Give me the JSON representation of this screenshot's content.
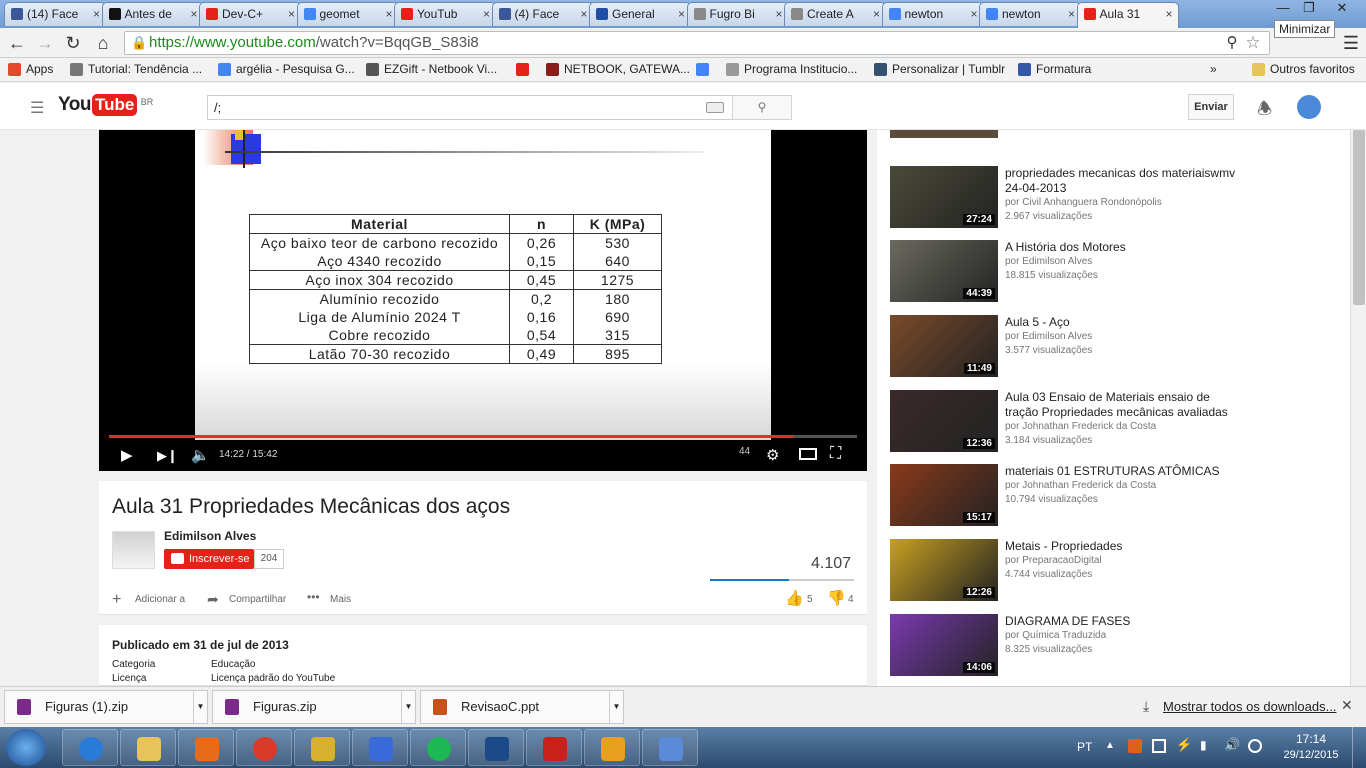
{
  "browser": {
    "tabs": [
      {
        "label": "(14) Face",
        "color": "#3b5998"
      },
      {
        "label": "Antes de",
        "color": "#111111"
      },
      {
        "label": "Dev-C+",
        "color": "#e62117"
      },
      {
        "label": "geomet",
        "color": "#4285f4"
      },
      {
        "label": "YouTub",
        "color": "#e62117"
      },
      {
        "label": "(4) Face",
        "color": "#3b5998"
      },
      {
        "label": "General",
        "color": "#1d4ea3"
      },
      {
        "label": "Fugro Bi",
        "color": "#888888"
      },
      {
        "label": "Create A",
        "color": "#888888"
      },
      {
        "label": "newton",
        "color": "#4285f4"
      },
      {
        "label": "newton",
        "color": "#4285f4"
      },
      {
        "label": "Aula 31",
        "color": "#e62117"
      }
    ],
    "tooltip": "Minimizar",
    "url_host": "https://www.youtube.com",
    "url_path": "/watch?v=BqqGB_S83i8",
    "bookmarks": [
      {
        "label": "Apps",
        "color": "#e04a2a"
      },
      {
        "label": "Tutorial: Tendência ...",
        "color": "#777777"
      },
      {
        "label": "argélia - Pesquisa G...",
        "color": "#4285f4"
      },
      {
        "label": "EZGift - Netbook Vi...",
        "color": "#555555"
      },
      {
        "label": "",
        "color": "#e62117"
      },
      {
        "label": "NETBOOK, GATEWA...",
        "color": "#8b1c1c"
      },
      {
        "label": "",
        "color": "#4285f4"
      },
      {
        "label": "Programa Institucio...",
        "color": "#999999"
      },
      {
        "label": "Personalizar | Tumblr",
        "color": "#34526f"
      },
      {
        "label": "Formatura",
        "color": "#3355aa"
      }
    ],
    "bookmarks_overflow": "»",
    "other_bookmarks": "Outros favoritos"
  },
  "youtube": {
    "logo_text": "YouTube",
    "logo_region": "BR",
    "search_value": "/;",
    "upload_label": "Enviar",
    "player": {
      "table_headers": [
        "Material",
        "n",
        "K (MPa)"
      ],
      "table_rows": [
        {
          "material": "Aço baixo teor de carbono recozido",
          "n": "0,26",
          "k": "530"
        },
        {
          "material": "Aço 4340 recozido",
          "n": "0,15",
          "k": "640"
        },
        {
          "material": "Aço inox 304 recozido",
          "n": "0,45",
          "k": "1275"
        },
        {
          "material": "Alumínio recozido",
          "n": "0,2",
          "k": "180"
        },
        {
          "material": "Liga de Alumínio 2024 T",
          "n": "0,16",
          "k": "690"
        },
        {
          "material": "Cobre recozido",
          "n": "0,54",
          "k": "315"
        },
        {
          "material": "Latão 70-30 recozido",
          "n": "0,49",
          "k": "895"
        }
      ],
      "time_current": "14:22",
      "time_total": "15:42",
      "progress_fraction": 0.915,
      "volume_number": "44"
    },
    "video": {
      "title": "Aula 31 Propriedades Mecânicas dos aços",
      "channel": "Edimilson Alves",
      "subscribe_label": "Inscrever-se",
      "subscriber_count": "204",
      "views": "4.107",
      "add_label": "Adicionar a",
      "share_label": "Compartilhar",
      "more_label": "Mais",
      "likes": "5",
      "dislikes": "4",
      "published": "Publicado em 31 de jul de 2013",
      "category_label": "Categoria",
      "category_value": "Educação",
      "license_label": "Licença",
      "license_value": "Licença padrão do YouTube"
    },
    "related": [
      {
        "title": "propriedades mecanicas dos materiaiswmv 24-04-2013",
        "channel": "por Civil Anhanguera Rondonópolis",
        "views": "2.967 visualizações",
        "duration": "27:24",
        "thumb_color": "#4a4a3a"
      },
      {
        "title": "A História dos Motores",
        "channel": "por Edimilson Alves",
        "views": "18.815 visualizações",
        "duration": "44:39",
        "thumb_color": "#6a6a60"
      },
      {
        "title": "Aula 5 - Aço",
        "channel": "por Edimilson Alves",
        "views": "3.577 visualizações",
        "duration": "11:49",
        "thumb_color": "#7a4a2a"
      },
      {
        "title": "Aula 03 Ensaio de Materiais ensaio de tração Propriedades mecânicas avaliadas",
        "channel": "por Johnathan Frederick da Costa",
        "views": "3.184 visualizações",
        "duration": "12:36",
        "thumb_color": "#3a2a2a"
      },
      {
        "title": "materiais 01 ESTRUTURAS ATÔMICAS",
        "channel": "por Johnathan Frederick da Costa",
        "views": "10.794 visualizações",
        "duration": "15:17",
        "thumb_color": "#8a3a1a"
      },
      {
        "title": "Metais - Propriedades",
        "channel": "por PreparacaoDigital",
        "views": "4.744 visualizações",
        "duration": "12:26",
        "thumb_color": "#c8a020"
      },
      {
        "title": "DIAGRAMA DE FASES",
        "channel": "por Química Traduzida",
        "views": "8.325 visualizações",
        "duration": "14:06",
        "thumb_color": "#7a3ab0"
      }
    ]
  },
  "downloads": {
    "items": [
      "Figuras (1).zip",
      "Figuras.zip",
      "RevisaoC.ppt"
    ],
    "show_all": "Mostrar todos os downloads..."
  },
  "taskbar": {
    "apps": [
      {
        "name": "internet-explorer",
        "color": "#2a7ad8"
      },
      {
        "name": "file-explorer",
        "color": "#e8c35a"
      },
      {
        "name": "media-player",
        "color": "#e86a1a"
      },
      {
        "name": "chrome",
        "color": "#d93a2a"
      },
      {
        "name": "app-yellow",
        "color": "#d8b030"
      },
      {
        "name": "app-blue",
        "color": "#3a6ad8"
      },
      {
        "name": "spotify",
        "color": "#1db954"
      },
      {
        "name": "dev-cpp",
        "color": "#1a4a8a"
      },
      {
        "name": "acrobat",
        "color": "#c8201a"
      },
      {
        "name": "outlook",
        "color": "#e8a020"
      },
      {
        "name": "paint",
        "color": "#5a8ad8"
      }
    ],
    "language": "PT",
    "time": "17:14",
    "date": "29/12/2015"
  }
}
